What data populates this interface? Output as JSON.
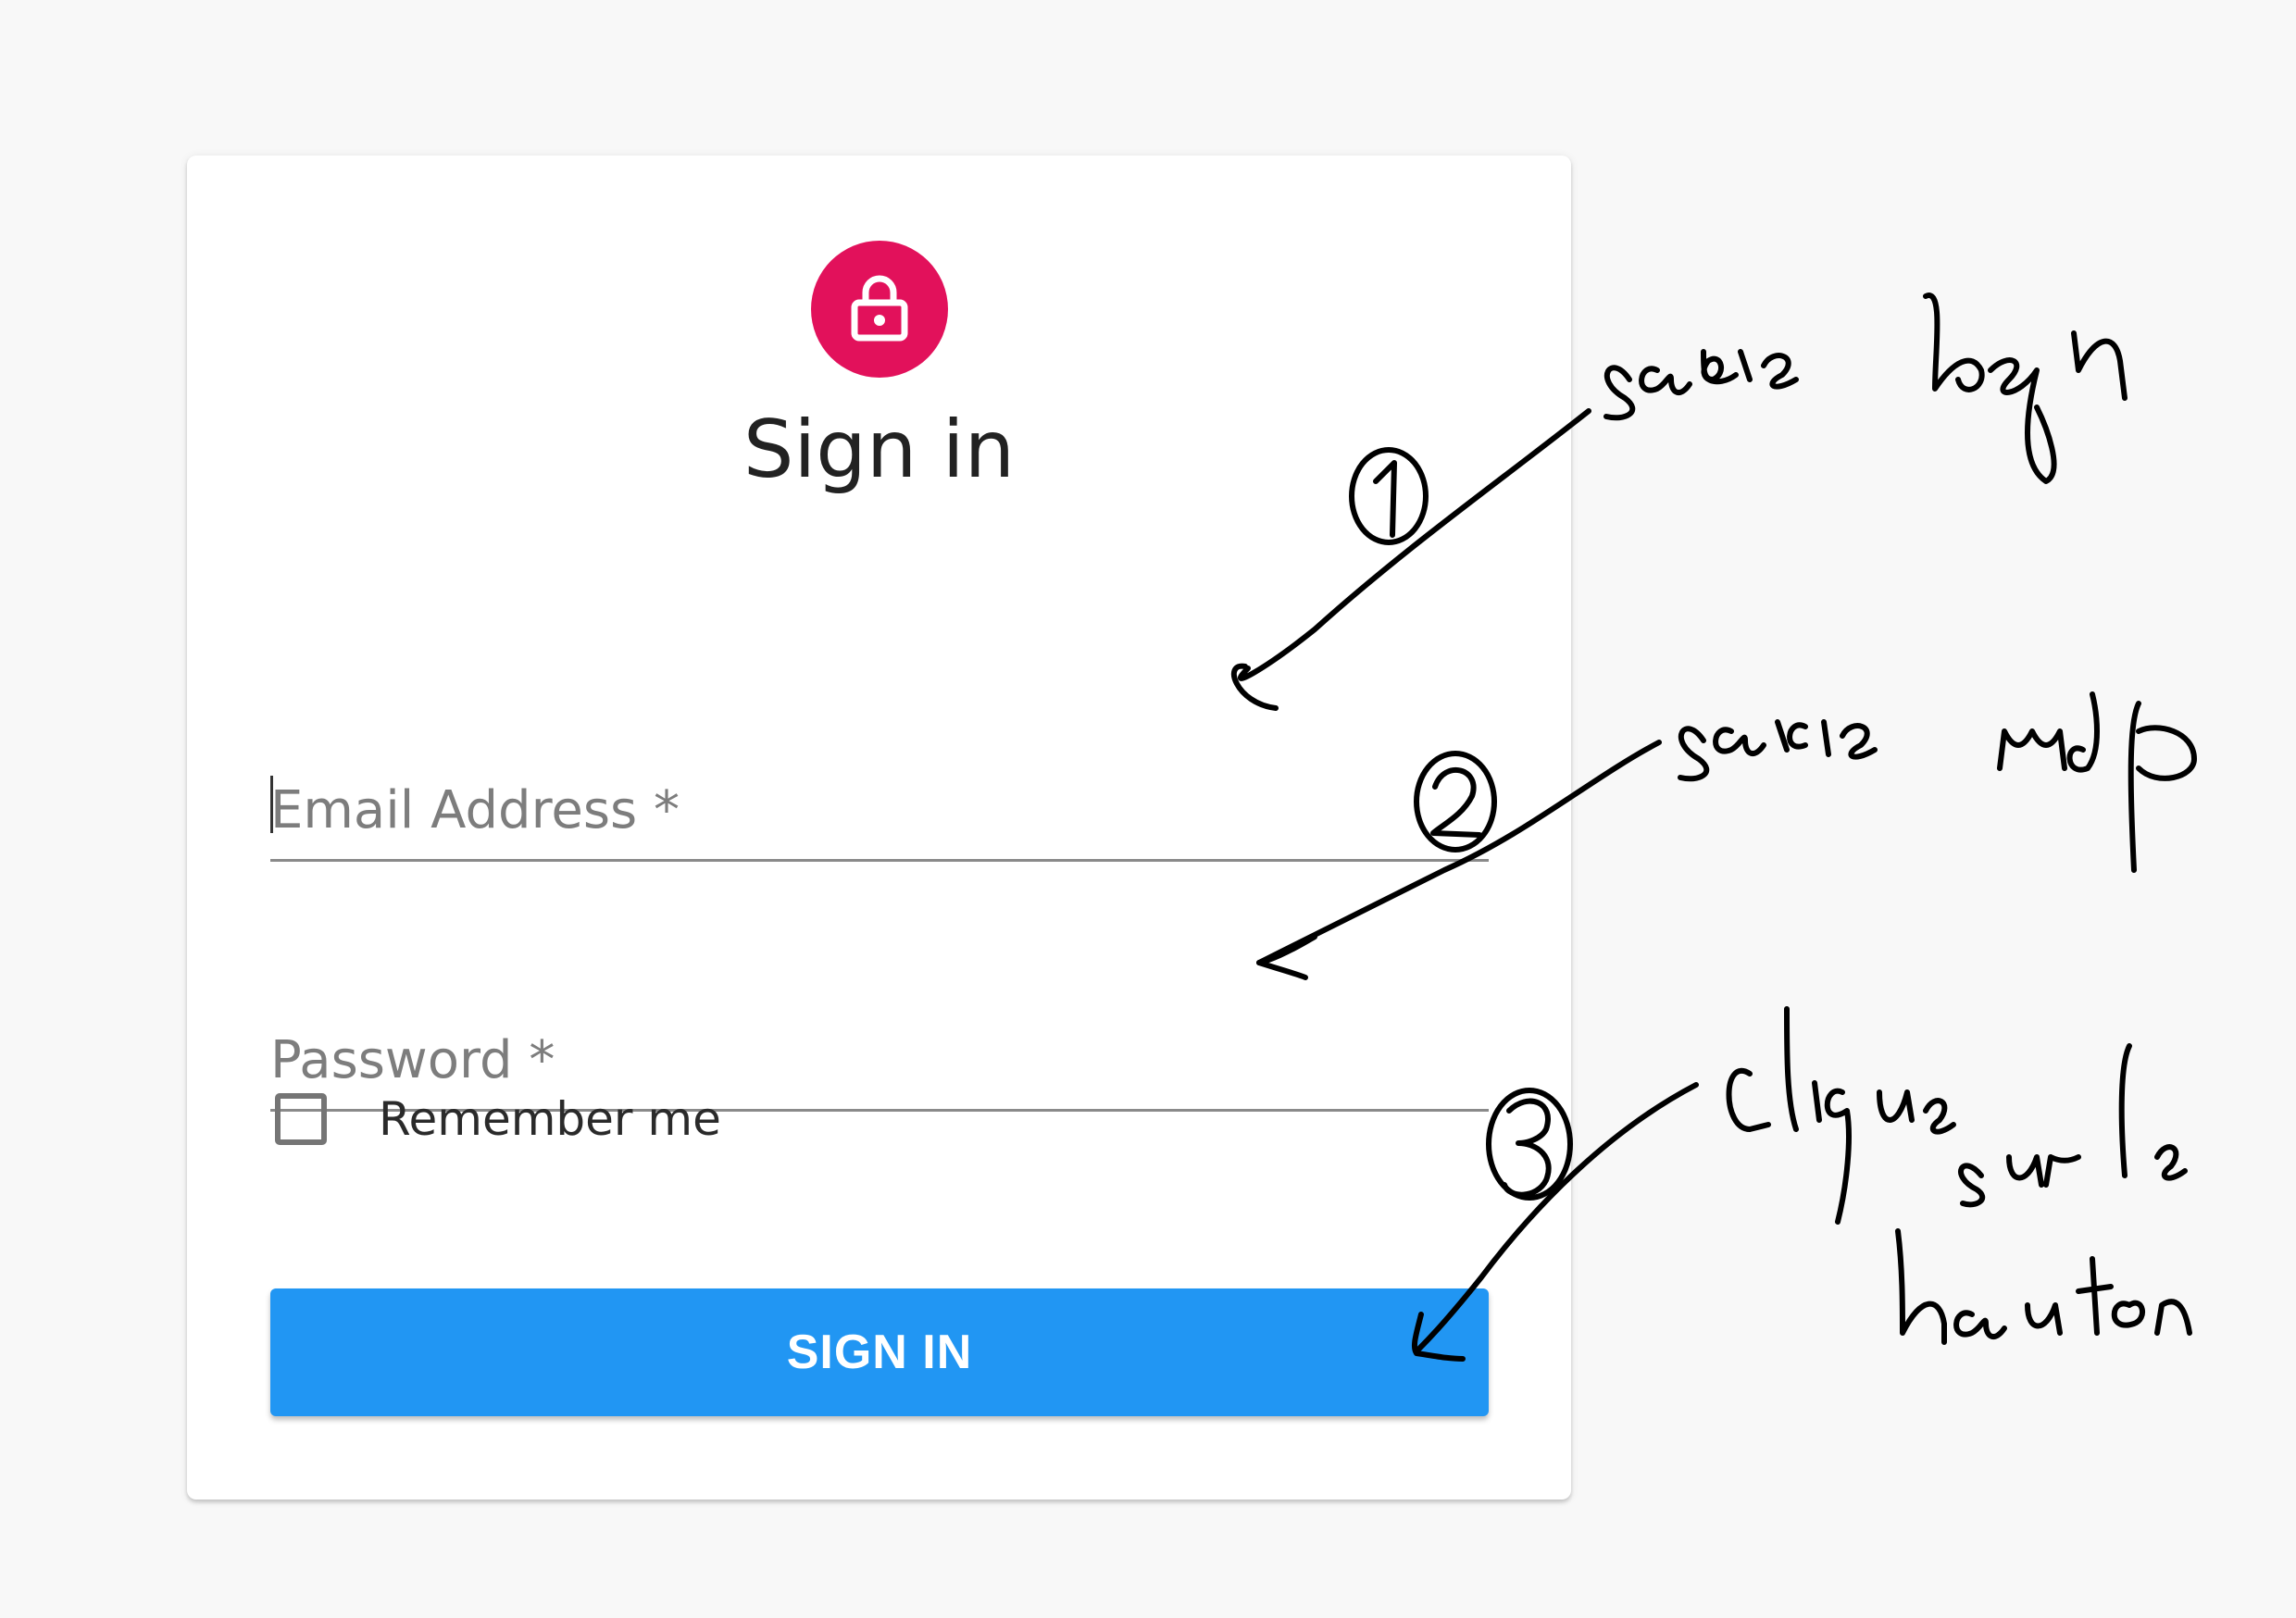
{
  "form": {
    "title": "Sign in",
    "icon": "lock-icon",
    "accent_color": "#e2115b",
    "email_placeholder": "Email Address *",
    "password_placeholder": "Password *",
    "remember_label": "Remember me",
    "submit_label": "SIGN IN",
    "button_color": "#2196f3"
  },
  "annotations": [
    {
      "number": "1",
      "text": "saisie login"
    },
    {
      "number": "2",
      "text": "saisie mdp"
    },
    {
      "number": "3",
      "text": "clique sur le bouton"
    }
  ]
}
